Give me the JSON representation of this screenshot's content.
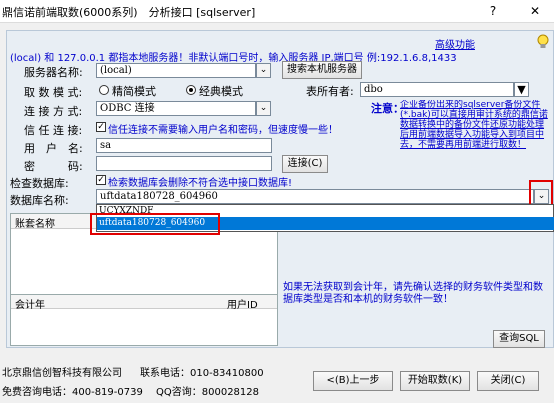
{
  "window": {
    "title": "鼎信诺前端取数(6000系列)　分析接口 [sqlserver]",
    "help_glyph": "?",
    "close_glyph": "✕"
  },
  "header": {
    "advanced_link": "高级功能",
    "info_line": "(local) 和 127.0.0.1 都指本地服务器！非默认端口号时，输入服务器 IP,端口号 例:192.1.6.8,1433",
    "bulb_icon": "lightbulb-icon"
  },
  "form": {
    "server_label": "服务器名称:",
    "server_value": "(local)",
    "search_server_button": "搜索本机服务器",
    "mode_label": "取 数 模 式:",
    "mode_options": [
      "精简模式",
      "经典模式"
    ],
    "mode_selected": "经典模式",
    "owner_label": "表所有者:",
    "owner_value": "dbo",
    "conn_label": "连 接 方 式:",
    "conn_value": "ODBC 连接",
    "trust_label": "信 任 连 接:",
    "trust_checkbox": "信任连接不需要输入用户名和密码，但速度慢一些！",
    "user_label": "用　户　名:",
    "user_value": "sa",
    "pwd_label": "密　　　码:",
    "pwd_value": "",
    "connect_button": "连接(C)",
    "checkdb_label": "检查数据库:",
    "checkdb_checkbox": "检索数据库会删除不符合选中接口数据库!",
    "dbname_label": "数据库名称:",
    "dbname_value": "uftdata180728_604960",
    "note_title": "注意：",
    "note_body": "企业备份出来的sqlserver备份文件(*.bak)可以直接用审计系统的鼎信诺数据转换中的备份文件还原功能处理后用前端数据导入功能导入到项目中去，不需要再用前端进行取数！"
  },
  "dropdown": {
    "items": [
      "UCYXZNDF",
      "uftdata180728_604960"
    ],
    "selected": "uftdata180728_604960"
  },
  "account_table": {
    "header": "账套名称"
  },
  "year_table": {
    "headers": [
      "会计年",
      "用户ID"
    ]
  },
  "warning": "如果无法获取到会计年，请先确认选择的财务软件类型和数据库类型是否和本机的财务软件一致！",
  "query_sql_button": "查询SQL",
  "footer": {
    "company": "北京鼎信创智科技有限公司",
    "phone": "联系电话：010-83410800",
    "hotline": "免费咨询电话：400-819-0739",
    "qq": "QQ咨询：800028128",
    "prev_button": "<(B)上一步",
    "start_button": "开始取数(K)",
    "close_button": "关闭(C)"
  },
  "colors": {
    "highlight": "#0078d7",
    "annot_red": "#e00000",
    "blue_text": "#0000cc",
    "panel_bg": "#e8eef4"
  }
}
